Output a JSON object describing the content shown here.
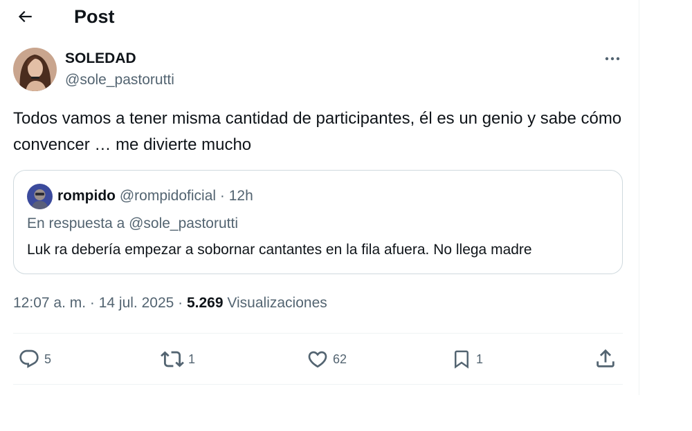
{
  "header": {
    "title": "Post"
  },
  "post": {
    "author_name": "SOLEDAD",
    "author_handle": "@sole_pastorutti",
    "text": "Todos vamos a tener misma cantidad de participantes, él es un genio y sabe cómo convencer … me divierte mucho",
    "time": "12:07 a. m. · 14 jul. 2025 · ",
    "views_count": "5.269",
    "views_label": "Visualizaciones"
  },
  "quote": {
    "author_name": "rompido",
    "author_handle": "@rompidoficial",
    "time_ago": "· 12h",
    "reply_to": "En respuesta a @sole_pastorutti",
    "text": "Luk ra debería empezar a sobornar cantantes en la fila afuera. No llega madre"
  },
  "actions": {
    "replies": "5",
    "reposts": "1",
    "likes": "62",
    "bookmarks": "1"
  },
  "icons": {
    "back": "arrow-left-icon",
    "more": "more-horizontal-icon",
    "reply": "comment-icon",
    "repost": "repost-icon",
    "like": "heart-icon",
    "bookmark": "bookmark-icon",
    "share": "share-icon"
  },
  "colors": {
    "text_primary": "#0f1419",
    "text_secondary": "#536471",
    "border": "#cfd9de"
  }
}
